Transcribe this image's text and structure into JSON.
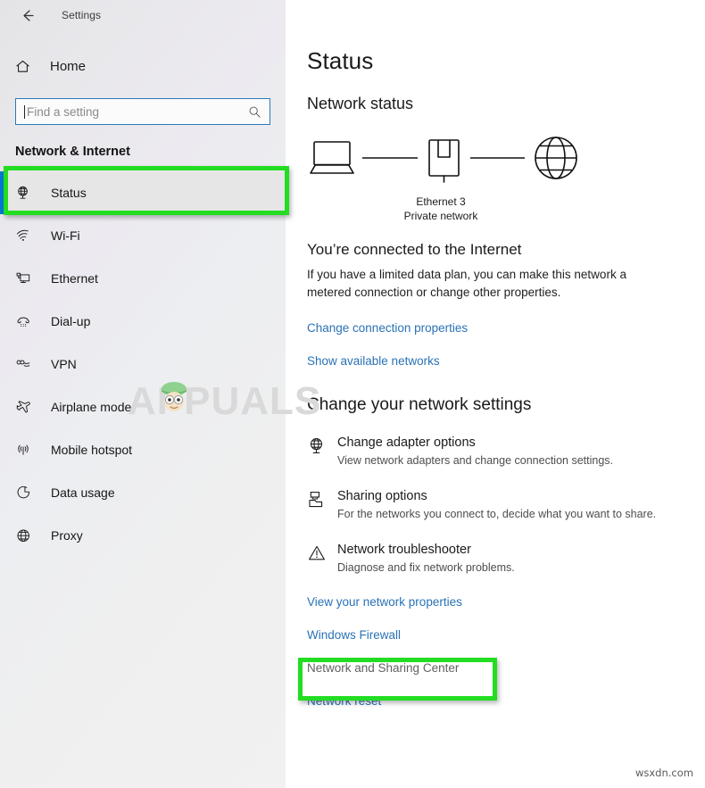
{
  "window": {
    "titlebar": {
      "back_icon": "back-arrow-icon",
      "title": "Settings"
    }
  },
  "sidebar": {
    "home": {
      "label": "Home",
      "icon": "home-icon"
    },
    "search": {
      "placeholder": "Find a setting",
      "value": "",
      "icon": "search-icon"
    },
    "category": "Network & Internet",
    "items": [
      {
        "label": "Status",
        "icon": "network-status-icon",
        "selected": true
      },
      {
        "label": "Wi-Fi",
        "icon": "wifi-icon",
        "selected": false
      },
      {
        "label": "Ethernet",
        "icon": "ethernet-icon",
        "selected": false
      },
      {
        "label": "Dial-up",
        "icon": "dialup-icon",
        "selected": false
      },
      {
        "label": "VPN",
        "icon": "vpn-icon",
        "selected": false
      },
      {
        "label": "Airplane mode",
        "icon": "airplane-icon",
        "selected": false
      },
      {
        "label": "Mobile hotspot",
        "icon": "hotspot-icon",
        "selected": false
      },
      {
        "label": "Data usage",
        "icon": "data-usage-icon",
        "selected": false
      },
      {
        "label": "Proxy",
        "icon": "proxy-globe-icon",
        "selected": false
      }
    ]
  },
  "main": {
    "page_title": "Status",
    "network_status_heading": "Network status",
    "diagram": {
      "device_icon": "laptop-icon",
      "adapter_icon": "ethernet-port-icon",
      "internet_icon": "globe-icon",
      "adapter_name": "Ethernet 3",
      "network_type": "Private network"
    },
    "connection_headline": "You’re connected to the Internet",
    "connection_description": "If you have a limited data plan, you can make this network a metered connection or change other properties.",
    "top_links": [
      {
        "label": "Change connection properties",
        "state": "normal"
      },
      {
        "label": "Show available networks",
        "state": "normal"
      }
    ],
    "change_settings_heading": "Change your network settings",
    "options": [
      {
        "icon": "adapter-globe-icon",
        "title": "Change adapter options",
        "description": "View network adapters and change connection settings."
      },
      {
        "icon": "sharing-folder-icon",
        "title": "Sharing options",
        "description": "For the networks you connect to, decide what you want to share."
      },
      {
        "icon": "warning-triangle-icon",
        "title": "Network troubleshooter",
        "description": "Diagnose and fix network problems."
      }
    ],
    "bottom_links": [
      {
        "label": "View your network properties",
        "state": "normal"
      },
      {
        "label": "Windows Firewall",
        "state": "normal"
      },
      {
        "label": "Network and Sharing Center",
        "state": "muted"
      },
      {
        "label": "Network reset",
        "state": "normal"
      }
    ]
  },
  "annotations": {
    "highlight_color": "#22dd22",
    "boxes": [
      {
        "name": "status-sidebar-highlight"
      },
      {
        "name": "network-and-sharing-center-highlight"
      }
    ]
  },
  "watermarks": {
    "center": "APPUALS",
    "corner": "wsxdn.com"
  },
  "colors": {
    "accent": "#0078d4",
    "link": "#2a72b5",
    "link_muted": "#616161",
    "sidebar_selected": "#e6e6e6"
  }
}
